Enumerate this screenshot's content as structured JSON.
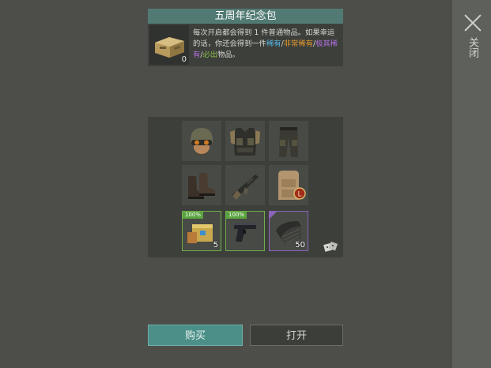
{
  "close": {
    "label": "关闭"
  },
  "pack": {
    "title": "五周年纪念包",
    "count": "0",
    "desc_prefix": "每次开启都会得到",
    "desc_num": "1",
    "desc_mid": "件普通物品。如果幸运的话，你还会得到一件",
    "rarity_rare": "稀有",
    "sep": "/",
    "rarity_very_rare": "非常稀有",
    "rarity_extreme": "极其稀有",
    "rarity_guaranteed": "必出",
    "desc_suffix": "物品。",
    "colors": {
      "rare": "#56b8e8",
      "very_rare": "#e69a2e",
      "extreme": "#b070e0",
      "guaranteed": "#88c04a"
    }
  },
  "items": [
    {
      "icon": "helmet-goggles-icon"
    },
    {
      "icon": "tactical-vest-icon"
    },
    {
      "icon": "tactical-pants-icon"
    },
    {
      "icon": "combat-boots-icon"
    },
    {
      "icon": "assault-rifle-icon"
    },
    {
      "icon": "backpack-icon"
    },
    {
      "icon": "ammo-crate-icon",
      "tag": "100%",
      "qty": "5"
    },
    {
      "icon": "pistol-icon",
      "tag": "100%"
    },
    {
      "icon": "metal-sheet-icon",
      "qty": "50"
    }
  ],
  "buttons": {
    "buy": "购买",
    "open": "打开"
  }
}
